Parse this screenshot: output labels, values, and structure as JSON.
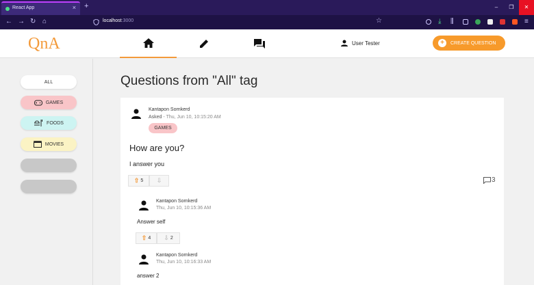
{
  "browser": {
    "tab_title": "React App",
    "tab_close": "×",
    "new_tab": "+",
    "url_host": "localhost",
    "url_port": ":3000",
    "window_buttons": [
      "–",
      "❐",
      "✕"
    ]
  },
  "header": {
    "logo": "QnA",
    "user_name": "User Tester",
    "create_label": "CREATE QUESTION",
    "accent_color": "#f79a2b"
  },
  "sidebar": {
    "items": [
      {
        "label": "ALL",
        "color": "#ffffff"
      },
      {
        "label": "GAMES",
        "color": "#f9c5c8",
        "icon": "gamepad-icon"
      },
      {
        "label": "FOODS",
        "color": "#cdf4f2",
        "icon": "food-icon"
      },
      {
        "label": "MOVIES",
        "color": "#fbf3c4",
        "icon": "movie-icon"
      }
    ]
  },
  "main": {
    "title": "Questions from \"All\" tag",
    "question": {
      "author": "Kantapon Sornkerd",
      "asked_prefix": "Asked",
      "date": " - Thu, Jun 10, 10:15:20 AM",
      "tag": "GAMES",
      "title": "How are you?",
      "body": "I answer you",
      "upvotes": "5",
      "comments": "3"
    },
    "answers": [
      {
        "author": "Kantapon Sornkerd",
        "date": "Thu, Jun 10, 10:15:36 AM",
        "body": "Answer self",
        "upvotes": "4",
        "downvotes": "2"
      },
      {
        "author": "Kantapon Sornkerd",
        "date": "Thu, Jun 10, 10:16:33 AM",
        "body": "answer 2"
      }
    ]
  }
}
